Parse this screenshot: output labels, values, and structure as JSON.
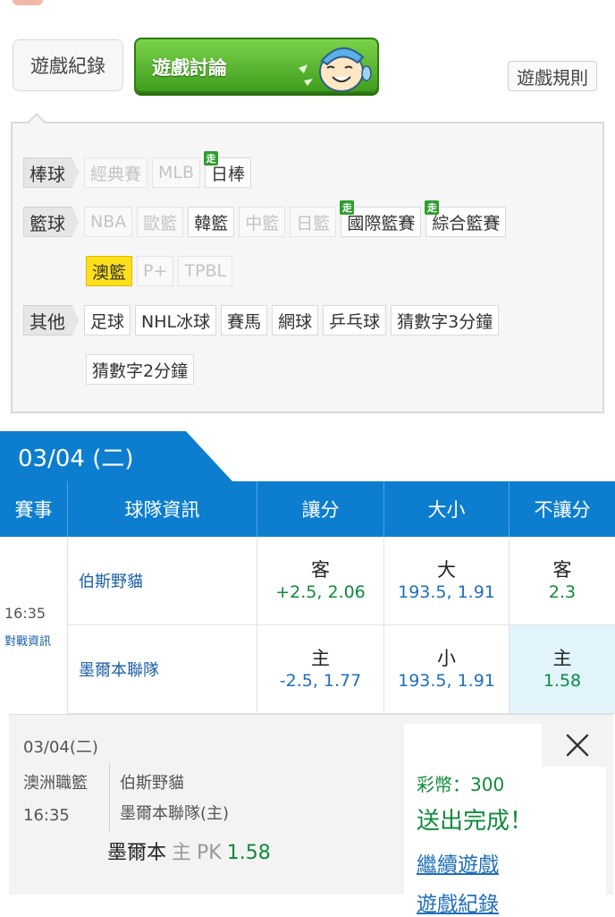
{
  "tabs": {
    "records": "遊戲紀錄",
    "discussion": "遊戲討論",
    "rules": "遊戲規則"
  },
  "filters": {
    "live_badge": "走",
    "baseball": {
      "label": "棒球",
      "items": [
        {
          "name": "經典賽",
          "state": "disabled"
        },
        {
          "name": "MLB",
          "state": "disabled"
        },
        {
          "name": "日棒",
          "state": "normal",
          "live": true
        }
      ]
    },
    "basketball": {
      "label": "籃球",
      "items": [
        {
          "name": "NBA",
          "state": "disabled"
        },
        {
          "name": "歐籃",
          "state": "disabled"
        },
        {
          "name": "韓籃",
          "state": "normal"
        },
        {
          "name": "中籃",
          "state": "disabled"
        },
        {
          "name": "日籃",
          "state": "disabled"
        },
        {
          "name": "國際籃賽",
          "state": "normal",
          "live": true
        },
        {
          "name": "綜合籃賽",
          "state": "normal",
          "live": true
        },
        {
          "name": "澳籃",
          "state": "active"
        },
        {
          "name": "P+",
          "state": "disabled"
        },
        {
          "name": "TPBL",
          "state": "disabled"
        }
      ]
    },
    "other": {
      "label": "其他",
      "items": [
        {
          "name": "足球",
          "state": "normal"
        },
        {
          "name": "NHL冰球",
          "state": "normal"
        },
        {
          "name": "賽馬",
          "state": "normal"
        },
        {
          "name": "網球",
          "state": "normal"
        },
        {
          "name": "乒乓球",
          "state": "normal"
        },
        {
          "name": "猜數字3分鐘",
          "state": "normal"
        },
        {
          "name": "猜數字2分鐘",
          "state": "normal"
        }
      ]
    }
  },
  "date_tab": "03/04 (二)",
  "table": {
    "headers": [
      "賽事",
      "球隊資訊",
      "讓分",
      "大小",
      "不讓分"
    ],
    "match": {
      "time": "16:35",
      "info_link": "對戰資訊",
      "away": {
        "team": "伯斯野貓",
        "spread_side": "客",
        "spread_val": "+2.5, 2.06",
        "total_side": "大",
        "total_val": "193.5, 1.91",
        "ml_side": "客",
        "ml_val": "2.3"
      },
      "home": {
        "team": "墨爾本聯隊",
        "spread_side": "主",
        "spread_val": "-2.5, 1.77",
        "total_side": "小",
        "total_val": "193.5, 1.91",
        "ml_side": "主",
        "ml_val": "1.58"
      }
    }
  },
  "popup": {
    "date": "03/04(二)",
    "league": "澳洲職籃",
    "time": "16:35",
    "team1": "伯斯野貓",
    "team2": "墨爾本聯隊(主)",
    "pick_team": "墨爾本",
    "pick_side": "主",
    "pick_type": "PK",
    "pick_odds": "1.58",
    "coins": "彩幣：300",
    "done": "送出完成！",
    "continue": "繼續遊戲",
    "next": "遊戲紀錄"
  },
  "colors": {
    "accent_blue": "#0d7ecf",
    "odds_green": "#0f8a3c",
    "active_chip": "#ffe01a"
  }
}
